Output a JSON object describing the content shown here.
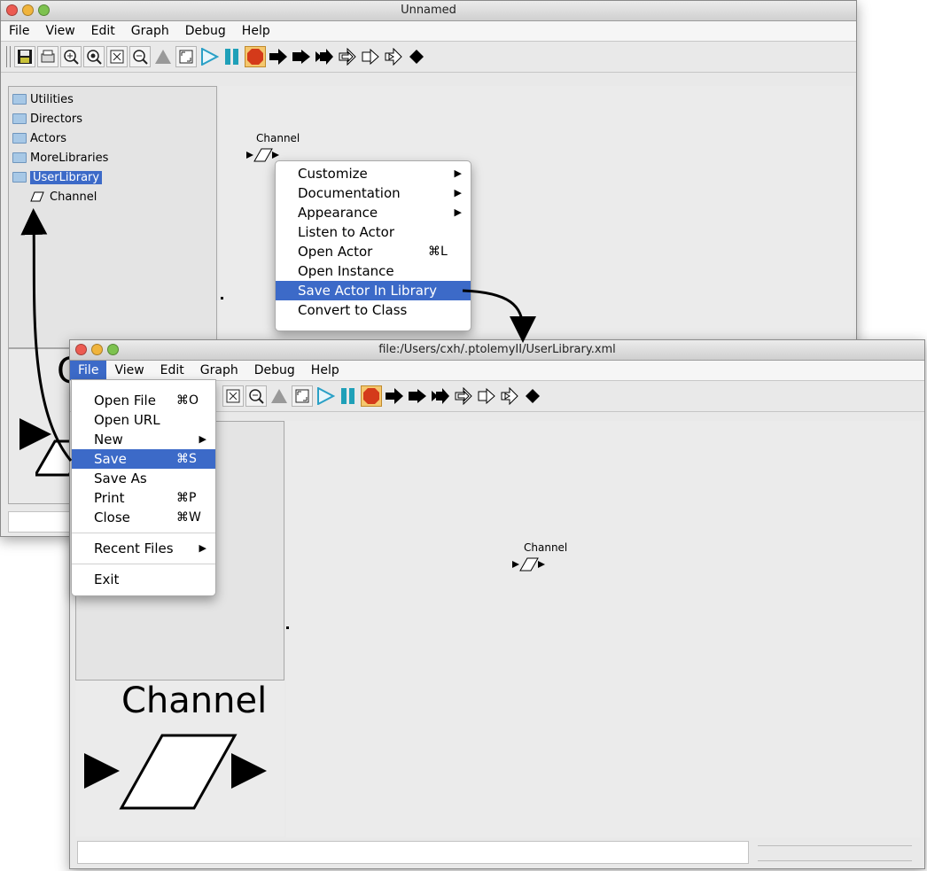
{
  "back_window": {
    "title": "Unnamed",
    "menus": [
      "File",
      "View",
      "Edit",
      "Graph",
      "Debug",
      "Help"
    ],
    "tree": [
      "Utilities",
      "Directors",
      "Actors",
      "MoreLibraries",
      "UserLibrary"
    ],
    "tree_child": "Channel",
    "actor_label": "Channel",
    "preview_fragment": "C"
  },
  "context_menu": {
    "items": [
      {
        "label": "Customize",
        "submenu": true,
        "shortcut": ""
      },
      {
        "label": "Documentation",
        "submenu": true,
        "shortcut": ""
      },
      {
        "label": "Appearance",
        "submenu": true,
        "shortcut": ""
      },
      {
        "label": "Listen to Actor",
        "submenu": false,
        "shortcut": ""
      },
      {
        "label": "Open Actor",
        "submenu": false,
        "shortcut": "⌘L"
      },
      {
        "label": "Open Instance",
        "submenu": false,
        "shortcut": ""
      },
      {
        "label": "Save Actor In Library",
        "submenu": false,
        "shortcut": "",
        "highlighted": true
      },
      {
        "label": "Convert to Class",
        "submenu": false,
        "shortcut": ""
      }
    ]
  },
  "front_window": {
    "title": "file:/Users/cxh/.ptolemyII/UserLibrary.xml",
    "menus": [
      "File",
      "View",
      "Edit",
      "Graph",
      "Debug",
      "Help"
    ],
    "actor_label": "Channel",
    "preview_label": "Channel"
  },
  "file_menu": {
    "items": [
      {
        "label": "Open File",
        "shortcut": "⌘O"
      },
      {
        "label": "Open URL",
        "shortcut": ""
      },
      {
        "label": "New",
        "shortcut": "",
        "submenu": true
      },
      {
        "label": "Save",
        "shortcut": "⌘S",
        "highlighted": true
      },
      {
        "label": "Save As",
        "shortcut": ""
      },
      {
        "label": "Print",
        "shortcut": "⌘P"
      },
      {
        "label": "Close",
        "shortcut": "⌘W"
      },
      {
        "label": "Recent Files",
        "shortcut": "",
        "submenu": true,
        "separator_before": true
      },
      {
        "label": "Exit",
        "shortcut": "",
        "separator_before": true
      }
    ]
  },
  "colors": {
    "highlight": "#3c6ac8",
    "stop_button": "#d43a1a",
    "play": "#2aa0c6",
    "pause": "#1fa0b8"
  },
  "toolbar_icons": [
    "save-icon",
    "print-icon",
    "zoom-in-icon",
    "zoom-reset-icon",
    "zoom-fit-icon",
    "zoom-out-icon",
    "up-icon",
    "full-screen-icon",
    "run-icon",
    "pause-icon",
    "stop-icon",
    "port-input-icon",
    "port-output-icon",
    "port-inout-icon",
    "multiport-input-icon",
    "multiport-output-icon",
    "multiport-inout-icon",
    "relation-icon"
  ]
}
